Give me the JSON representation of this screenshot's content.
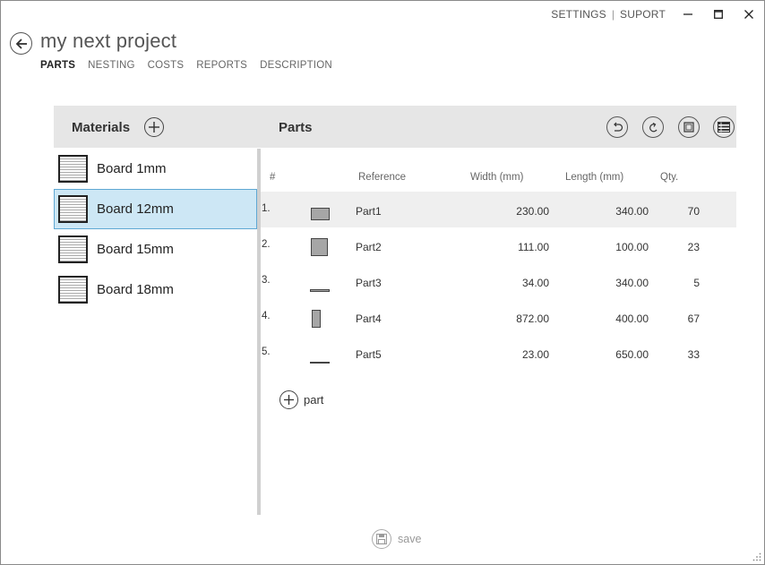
{
  "topbar": {
    "settings": "SETTINGS",
    "separator": "|",
    "support": "SUPORT"
  },
  "header": {
    "title": "my next project",
    "tabs": [
      {
        "label": "PARTS",
        "active": true
      },
      {
        "label": "NESTING",
        "active": false
      },
      {
        "label": "COSTS",
        "active": false
      },
      {
        "label": "REPORTS",
        "active": false
      },
      {
        "label": "DESCRIPTION",
        "active": false
      }
    ]
  },
  "materials": {
    "title": "Materials",
    "items": [
      {
        "label": "Board 1mm",
        "selected": false
      },
      {
        "label": "Board 12mm",
        "selected": true
      },
      {
        "label": "Board 15mm",
        "selected": false
      },
      {
        "label": "Board 18mm",
        "selected": false
      }
    ]
  },
  "parts": {
    "title": "Parts",
    "columns": {
      "num": "#",
      "reference": "Reference",
      "width": "Width (mm)",
      "length": "Length (mm)",
      "qty": "Qty."
    },
    "rows": [
      {
        "num": "1.",
        "reference": "Part1",
        "width": "230.00",
        "length": "340.00",
        "qty": "70"
      },
      {
        "num": "2.",
        "reference": "Part2",
        "width": "111.00",
        "length": "100.00",
        "qty": "23"
      },
      {
        "num": "3.",
        "reference": "Part3",
        "width": "34.00",
        "length": "340.00",
        "qty": "5"
      },
      {
        "num": "4.",
        "reference": "Part4",
        "width": "872.00",
        "length": "400.00",
        "qty": "67"
      },
      {
        "num": "5.",
        "reference": "Part5",
        "width": "23.00",
        "length": "650.00",
        "qty": "33"
      }
    ],
    "add_label": "part"
  },
  "footer": {
    "save_label": "save"
  },
  "icons": {
    "back": "arrow-left-icon",
    "add": "plus-icon",
    "undo": "undo-icon",
    "redo": "redo-icon",
    "layout": "frame-icon",
    "list": "list-icon",
    "save": "floppy-disk-icon"
  },
  "colors": {
    "selection_bg": "#cde7f5",
    "selection_border": "#5fa8d3",
    "header_bg": "#e6e6e6",
    "row_highlight": "#efefef"
  }
}
